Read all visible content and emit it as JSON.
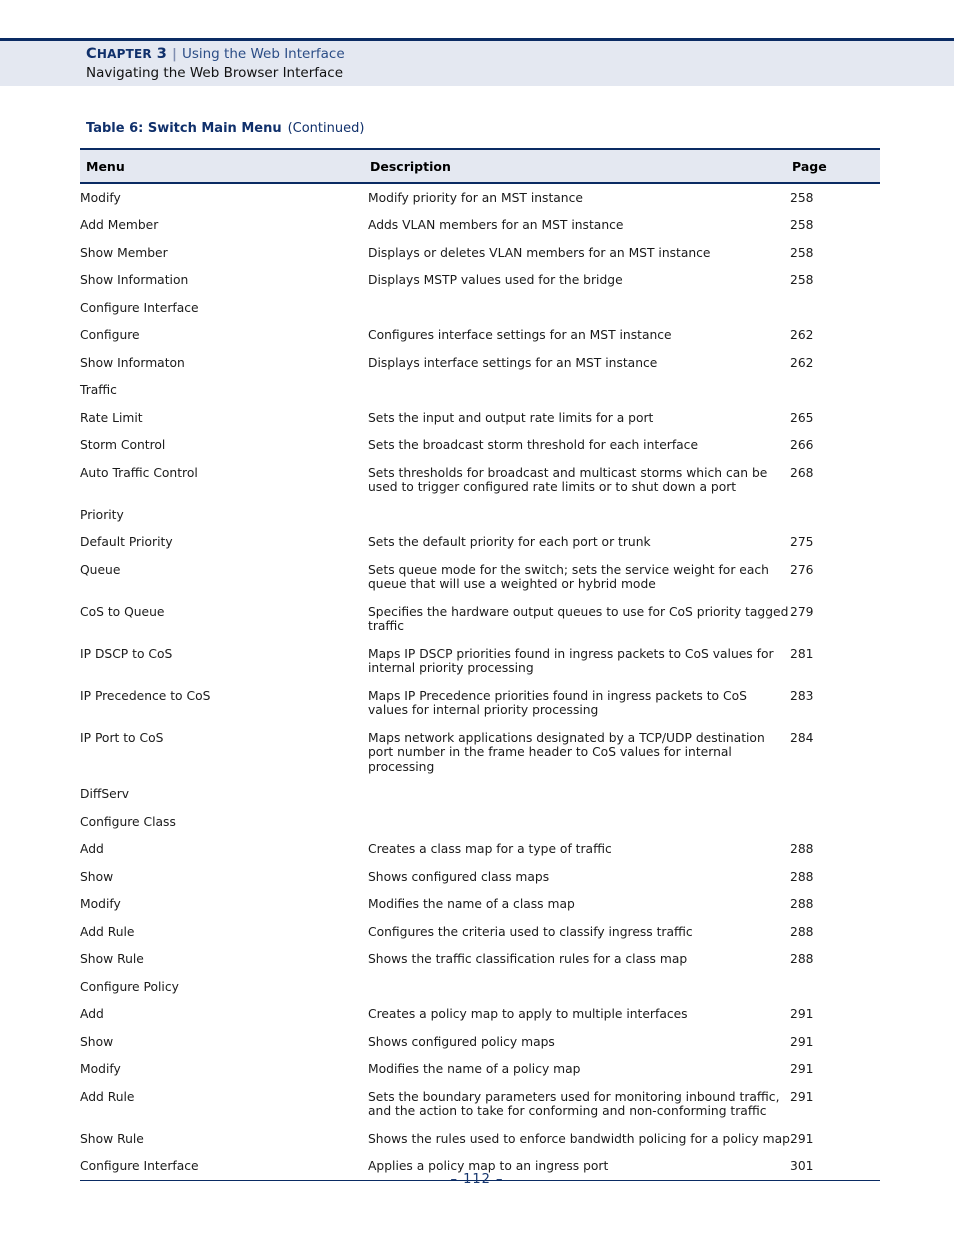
{
  "header": {
    "chapter_label": "Chapter 3",
    "chapter_label_cap": "C",
    "chapter_label_rest": "HAPTER",
    "chapter_number": "3",
    "separator": "|",
    "chapter_title": "Using the Web Interface",
    "section_title": "Navigating the Web Browser Interface"
  },
  "table_caption": {
    "main": "Table 6: Switch Main Menu",
    "continued": "(Continued)"
  },
  "columns": {
    "menu": "Menu",
    "description": "Description",
    "page": "Page"
  },
  "rows": [
    {
      "level": 2,
      "menu": "Modify",
      "description": "Modify priority for an MST instance",
      "page": "258"
    },
    {
      "level": 2,
      "menu": "Add Member",
      "description": "Adds VLAN members for an MST instance",
      "page": "258"
    },
    {
      "level": 2,
      "menu": "Show Member",
      "description": "Displays or deletes VLAN members for an MST instance",
      "page": "258"
    },
    {
      "level": 2,
      "menu": "Show Information",
      "description": "Displays MSTP values used for the bridge",
      "page": "258"
    },
    {
      "level": 1,
      "menu": "Configure Interface",
      "description": "",
      "page": ""
    },
    {
      "level": 2,
      "menu": "Configure",
      "description": "Configures interface settings for an MST instance",
      "page": "262"
    },
    {
      "level": 2,
      "menu": "Show Informaton",
      "description": "Displays interface settings for an MST instance",
      "page": "262"
    },
    {
      "level": 0,
      "menu": "Traffic",
      "description": "",
      "page": ""
    },
    {
      "level": 1,
      "menu": "Rate Limit",
      "description": "Sets the input and output rate limits for a port",
      "page": "265"
    },
    {
      "level": 1,
      "menu": "Storm Control",
      "description": "Sets the broadcast storm threshold for each interface",
      "page": "266"
    },
    {
      "level": 1,
      "menu": "Auto Traffic Control",
      "description": "Sets thresholds for broadcast and multicast storms which can be used to trigger configured rate limits or to shut down a port",
      "page": "268"
    },
    {
      "level": 1,
      "menu": "Priority",
      "description": "",
      "page": ""
    },
    {
      "level": 2,
      "menu": "Default Priority",
      "description": "Sets the default priority for each port or trunk",
      "page": "275"
    },
    {
      "level": 2,
      "menu": "Queue",
      "description": "Sets queue mode for the switch; sets the service weight for each queue that will use a weighted or hybrid mode",
      "page": "276"
    },
    {
      "level": 2,
      "menu": "CoS to Queue",
      "description": "Specifies the hardware output queues to use for CoS priority tagged traffic",
      "page": "279"
    },
    {
      "level": 2,
      "menu": "IP DSCP to CoS",
      "description": "Maps IP DSCP priorities found in ingress packets to CoS values for internal priority processing",
      "page": "281"
    },
    {
      "level": 2,
      "menu": "IP Precedence to CoS",
      "description": "Maps IP Precedence priorities found in ingress packets to CoS values for internal priority processing",
      "page": "283"
    },
    {
      "level": 2,
      "menu": "IP Port to CoS",
      "description": "Maps network applications designated by a TCP/UDP destination port number in the frame header to CoS values for internal processing",
      "page": "284"
    },
    {
      "level": 1,
      "menu": "DiffServ",
      "description": "",
      "page": ""
    },
    {
      "level": 2,
      "menu": "Configure Class",
      "description": "",
      "page": ""
    },
    {
      "level": 3,
      "menu": "Add",
      "description": "Creates a class map for a type of traffic",
      "page": "288"
    },
    {
      "level": 3,
      "menu": "Show",
      "description": "Shows configured class maps",
      "page": "288"
    },
    {
      "level": 3,
      "menu": "Modify",
      "description": "Modifies the name of a class map",
      "page": "288"
    },
    {
      "level": 3,
      "menu": "Add Rule",
      "description": "Configures the criteria used to classify ingress traffic",
      "page": "288"
    },
    {
      "level": 3,
      "menu": "Show Rule",
      "description": "Shows the traffic classification rules for a class map",
      "page": "288"
    },
    {
      "level": 2,
      "menu": "Configure Policy",
      "description": "",
      "page": ""
    },
    {
      "level": 3,
      "menu": "Add",
      "description": "Creates a policy map to apply to multiple interfaces",
      "page": "291"
    },
    {
      "level": 3,
      "menu": "Show",
      "description": "Shows configured policy maps",
      "page": "291"
    },
    {
      "level": 3,
      "menu": "Modify",
      "description": "Modifies the name of a policy map",
      "page": "291"
    },
    {
      "level": 3,
      "menu": "Add Rule",
      "description": "Sets the boundary parameters used for monitoring inbound traffic, and the action to take for conforming and non-conforming traffic",
      "page": "291"
    },
    {
      "level": 3,
      "menu": "Show Rule",
      "description": "Shows the rules used to enforce bandwidth policing for a policy map",
      "page": "291"
    },
    {
      "level": 2,
      "menu": "Configure Interface",
      "description": "Applies a policy map to an ingress port",
      "page": "301"
    }
  ],
  "footer": {
    "page_number": "–  112  –"
  },
  "colors": {
    "rule_navy": "#0a2b63",
    "header_band": "#e4e8f1",
    "link_blue": "#1c1cdd",
    "title_blue": "#2b4d86"
  }
}
